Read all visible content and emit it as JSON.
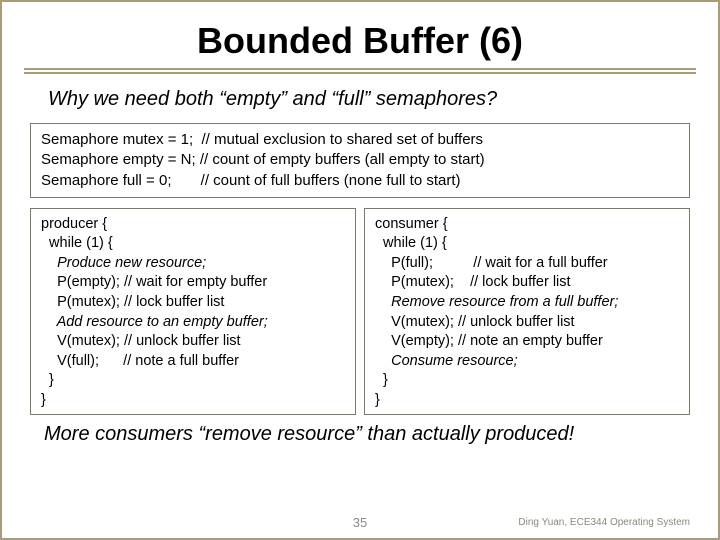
{
  "title": "Bounded Buffer (6)",
  "subtitle": "Why we need both “empty” and “full” semaphores?",
  "decl": {
    "l1": "Semaphore mutex = 1;  // mutual exclusion to shared set of buffers",
    "l2": "Semaphore empty = N; // count of empty buffers (all empty to start)",
    "l3": "Semaphore full = 0;       // count of full buffers (none full to start)"
  },
  "producer": {
    "l1": "producer {",
    "l2": "  while (1) {",
    "l3": "    Produce new resource;",
    "l4": "    P(empty); // wait for empty buffer",
    "l5": "    P(mutex); // lock buffer list",
    "l6": "    Add resource to an empty buffer;",
    "l7": "    V(mutex); // unlock buffer list",
    "l8": "    V(full);      // note a full buffer",
    "l9": "  }",
    "l10": "}"
  },
  "consumer": {
    "l1": "consumer {",
    "l2": "  while (1) {",
    "l3": "    P(full);          // wait for a full buffer",
    "l4": "    P(mutex);    // lock buffer list",
    "l5": "    Remove resource from a full buffer;",
    "l6": "    V(mutex); // unlock buffer list",
    "l7": "    V(empty); // note an empty buffer",
    "l8": "    Consume resource;",
    "l9": "  }",
    "l10": "}"
  },
  "bottom": "More consumers “remove resource” than actually produced!",
  "page": "35",
  "attribution": "Ding Yuan, ECE344 Operating System"
}
